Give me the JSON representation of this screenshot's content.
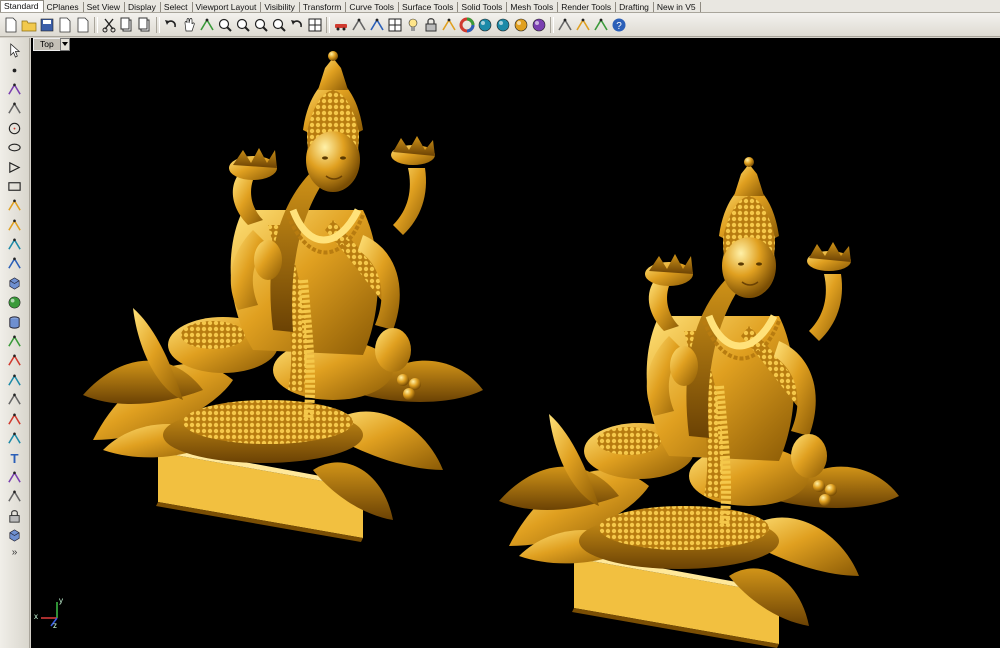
{
  "tabs": [
    {
      "label": "Standard",
      "active": true
    },
    {
      "label": "CPlanes"
    },
    {
      "label": "Set View"
    },
    {
      "label": "Display"
    },
    {
      "label": "Select"
    },
    {
      "label": "Viewport Layout"
    },
    {
      "label": "Visibility"
    },
    {
      "label": "Transform"
    },
    {
      "label": "Curve Tools"
    },
    {
      "label": "Surface Tools"
    },
    {
      "label": "Solid Tools"
    },
    {
      "label": "Mesh Tools"
    },
    {
      "label": "Render Tools"
    },
    {
      "label": "Drafting"
    },
    {
      "label": "New in V5"
    }
  ],
  "toolbar_icons": [
    "new-file-icon",
    "open-folder-icon",
    "save-icon",
    "print-icon",
    "import-icon",
    "cut-icon",
    "copy-icon",
    "paste-icon",
    "undo-icon",
    "pan-hand-icon",
    "rotate-view-icon",
    "zoom-icon",
    "zoom-window-icon",
    "zoom-extents-icon",
    "zoom-selected-icon",
    "undo-view-icon",
    "four-viewports-icon",
    "car-icon",
    "pipe-icon",
    "cplane-icon",
    "grid-icon",
    "light-bulb-icon",
    "lock-icon",
    "layer-icon",
    "color-wheel-icon",
    "shaded-sphere-icon",
    "render-sphere-icon",
    "ghosted-sphere-icon",
    "blue-sphere-icon",
    "options-icon",
    "settings-icon",
    "osnap-icon",
    "help-icon"
  ],
  "left_icons": [
    "select-arrow-icon",
    "point-icon",
    "polyline-icon",
    "curve-icon",
    "circle-icon",
    "ellipse-icon",
    "polygon-icon",
    "rectangle-icon",
    "arc-icon",
    "fillet-icon",
    "surface-icon",
    "extrude-icon",
    "box-icon",
    "sphere-icon",
    "cylinder-icon",
    "mesh-icon",
    "boolean-icon",
    "join-icon",
    "trim-icon",
    "split-icon",
    "rotate-icon",
    "text-icon",
    "dimension-icon",
    "array-icon",
    "block-icon",
    "solid-icon"
  ],
  "more_glyph": "»",
  "viewport": {
    "title": "Top"
  },
  "axes": {
    "x_label": "x",
    "y_label": "y",
    "z_label": "z"
  },
  "colors": {
    "viewport_bg": "#000000",
    "model_gold": "#e0a020",
    "ui_bg": "#d4d0c8"
  }
}
